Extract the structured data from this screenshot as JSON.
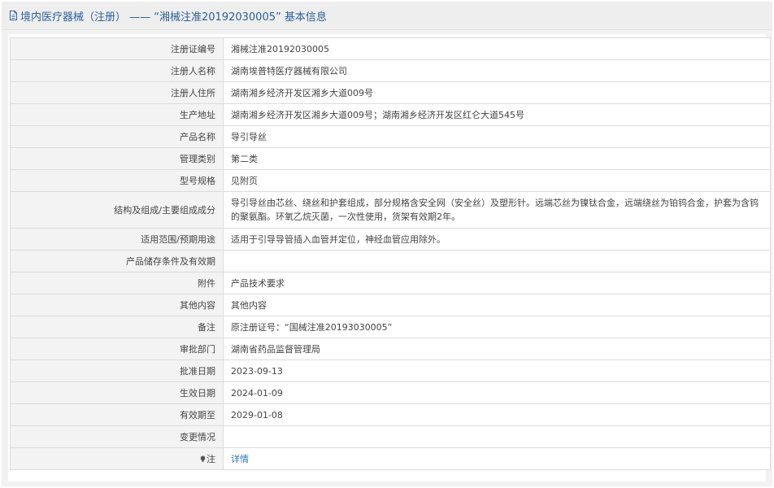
{
  "header": {
    "title": "境内医疗器械（注册） —— “湘械注准20192030005” 基本信息"
  },
  "rows": [
    {
      "label": "注册证编号",
      "value": "湘械注准20192030005"
    },
    {
      "label": "注册人名称",
      "value": "湖南埃普特医疗器械有限公司"
    },
    {
      "label": "注册人住所",
      "value": "湖南湘乡经济开发区湘乡大道009号"
    },
    {
      "label": "生产地址",
      "value": "湖南湘乡经济开发区湘乡大道009号；湖南湘乡经济开发区红仑大道545号"
    },
    {
      "label": "产品名称",
      "value": "导引导丝"
    },
    {
      "label": "管理类别",
      "value": "第二类"
    },
    {
      "label": "型号规格",
      "value": "见附页"
    },
    {
      "label": "结构及组成/主要组成成分",
      "value": "导引导丝由芯丝、绕丝和护套组成，部分规格含安全网（安全丝）及塑形针。远端芯丝为镍钛合金，远端绕丝为铂钨合金，护套为含钨的聚氨酯。环氧乙烷灭菌，一次性使用，货架有效期2年。"
    },
    {
      "label": "适用范围/预期用途",
      "value": "适用于引导导管插入血管并定位，神经血管应用除外。"
    },
    {
      "label": "产品储存条件及有效期",
      "value": ""
    },
    {
      "label": "附件",
      "value": "产品技术要求"
    },
    {
      "label": "其他内容",
      "value": "其他内容"
    },
    {
      "label": "备注",
      "value": "原注册证号：“国械注准20193030005”"
    },
    {
      "label": "审批部门",
      "value": "湖南省药品监督管理局"
    },
    {
      "label": "批准日期",
      "value": "2023-09-13"
    },
    {
      "label": "生效日期",
      "value": "2024-01-09"
    },
    {
      "label": "有效期至",
      "value": "2029-01-08"
    },
    {
      "label": "变更情况",
      "value": ""
    },
    {
      "label": "注",
      "value": "详情"
    }
  ],
  "colors": {
    "title": "#2a5f9a",
    "link": "#2a73c2",
    "label_bg": "#f3f3f3",
    "border": "#dcdcdc"
  }
}
